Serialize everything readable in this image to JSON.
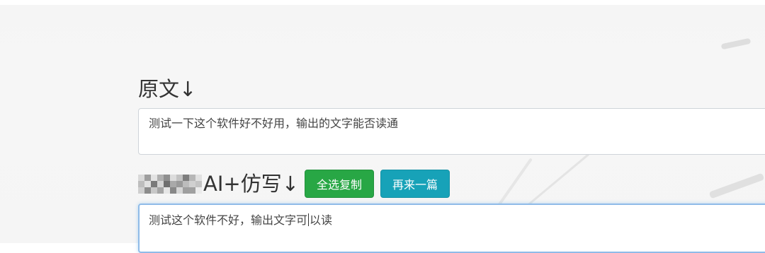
{
  "original": {
    "title": "原文↓",
    "text": "测试一下这个软件好不好用，输出的文字能否读通"
  },
  "rewrite": {
    "title": "AI+仿写↓",
    "copy_button": "全选复制",
    "again_button": "再来一篇",
    "text_before_caret": "测试这个软件不好，输出文字可",
    "text_after_caret": "以读"
  },
  "colors": {
    "copy_button_bg": "#28a745",
    "again_button_bg": "#17a2b8",
    "focus_border": "#8fbbe8"
  }
}
